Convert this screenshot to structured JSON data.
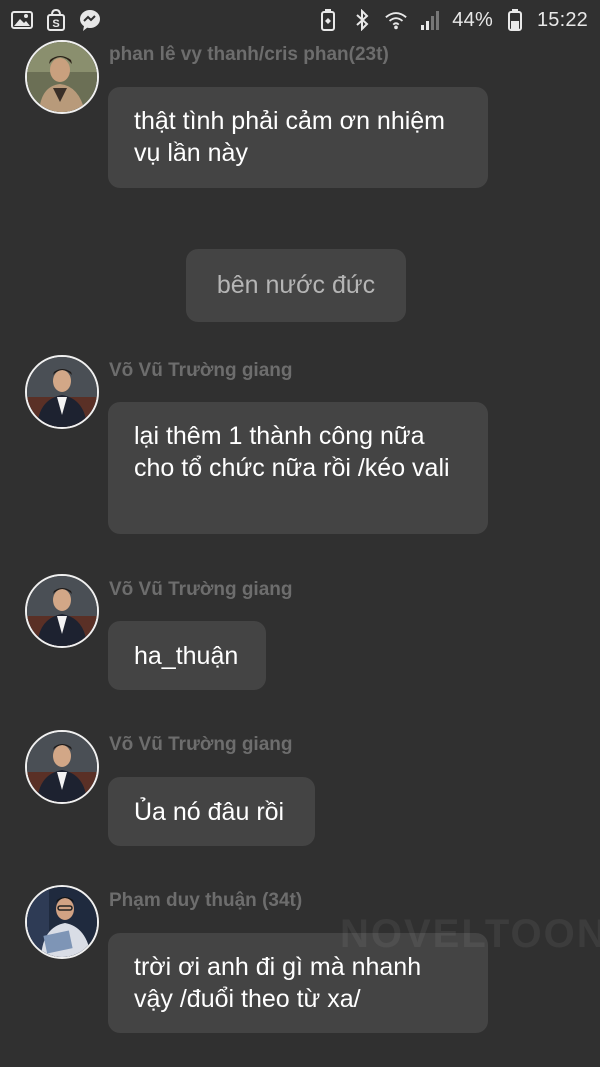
{
  "status_bar": {
    "icons_left": [
      "gallery-icon",
      "shop-icon",
      "messenger-icon"
    ],
    "icons_right": [
      "battery-saver-icon",
      "bluetooth-icon",
      "wifi-icon",
      "signal-icon"
    ],
    "battery": "44%",
    "time": "15:22"
  },
  "messages": [
    {
      "sender": "phan lê vy thanh/cris phan(23t)",
      "text": "thật tình phải cảm ơn nhiệm vụ lần này"
    },
    {
      "sender": "Võ Vũ Trường giang",
      "text": "lại thêm 1 thành công nữa cho tổ chức nữa rồi /kéo vali"
    },
    {
      "sender": "Võ Vũ Trường giang",
      "text": "ha_thuận"
    },
    {
      "sender": "Võ Vũ Trường giang",
      "text": "Ủa nó đâu rồi"
    },
    {
      "sender": "Phạm duy thuận (34t)",
      "text": "trời ơi anh đi gì mà nhanh vậy /đuổi theo từ xa/"
    }
  ],
  "narration": {
    "text": "bên nước đức"
  },
  "watermark": "NOVELTOON",
  "colors": {
    "background": "#303030",
    "bubble": "#444444",
    "sender": "#6d6d6d"
  }
}
